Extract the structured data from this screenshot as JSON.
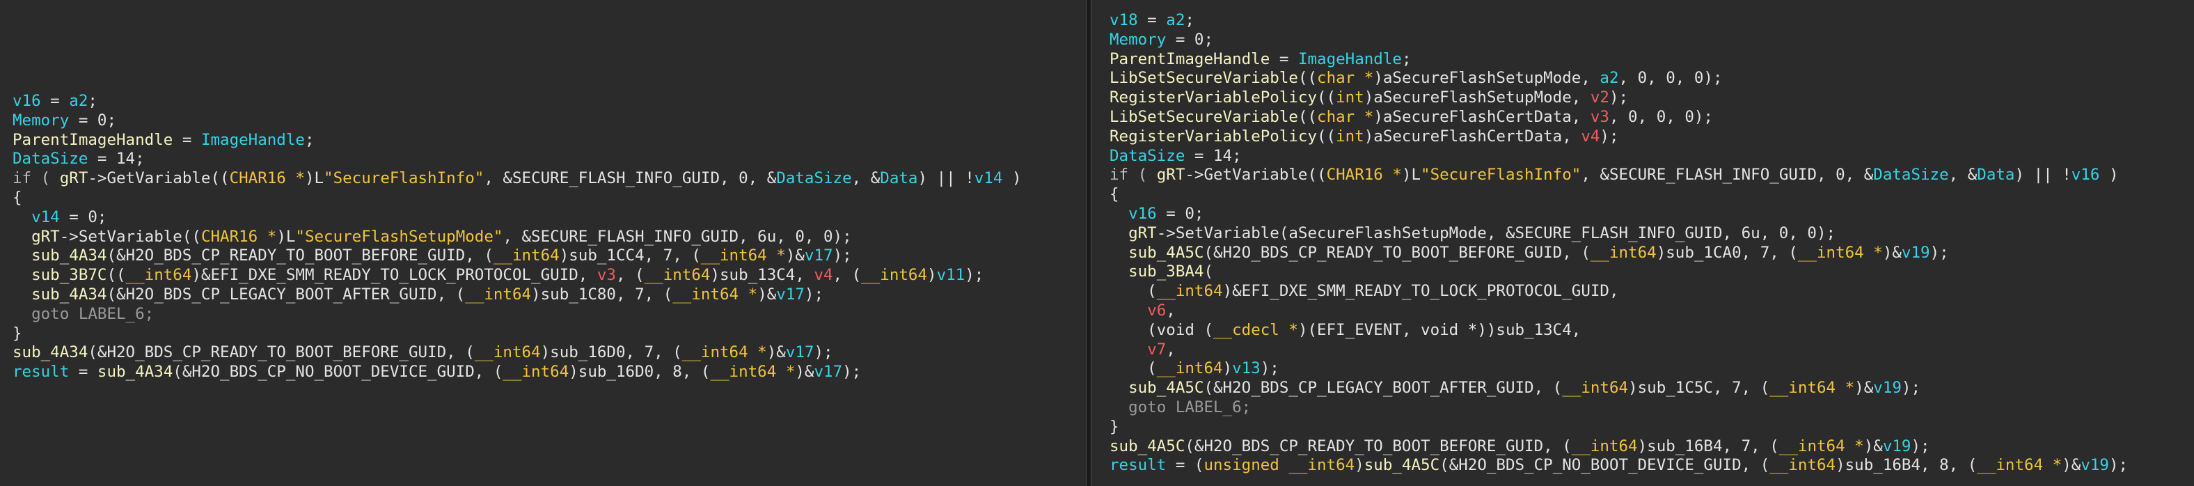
{
  "colors": {
    "background": "#2b2b2b",
    "identifier_cyan": "#37d1e6",
    "type_yellow": "#f0c33c",
    "function_cream": "#f3f1c1",
    "register_red": "#ef5d5d",
    "text_default": "#e3e3e3"
  },
  "left_pane": {
    "lines": [
      [
        {
          "t": "v16",
          "c": "var"
        },
        {
          "t": " = ",
          "c": "default"
        },
        {
          "t": "a2",
          "c": "var"
        },
        {
          "t": ";",
          "c": "default"
        }
      ],
      [
        {
          "t": "Memory",
          "c": "var"
        },
        {
          "t": " = 0;",
          "c": "default"
        }
      ],
      [
        {
          "t": "ParentImageHandle",
          "c": "fn"
        },
        {
          "t": " = ",
          "c": "default"
        },
        {
          "t": "ImageHandle",
          "c": "var"
        },
        {
          "t": ";",
          "c": "default"
        }
      ],
      [
        {
          "t": "DataSize",
          "c": "var"
        },
        {
          "t": " = 14;",
          "c": "default"
        }
      ],
      [
        {
          "t": "if ( ",
          "c": "kw"
        },
        {
          "t": "gRT",
          "c": "fn"
        },
        {
          "t": "->GetVariable((",
          "c": "default"
        },
        {
          "t": "CHAR16 *",
          "c": "type"
        },
        {
          "t": ")L",
          "c": "default"
        },
        {
          "t": "\"SecureFlashInfo\"",
          "c": "str"
        },
        {
          "t": ", &SECURE_FLASH_INFO_GUID, 0, &",
          "c": "default"
        },
        {
          "t": "DataSize",
          "c": "var"
        },
        {
          "t": ", &",
          "c": "default"
        },
        {
          "t": "Data",
          "c": "var"
        },
        {
          "t": ") || !",
          "c": "default"
        },
        {
          "t": "v14",
          "c": "var"
        },
        {
          "t": " )",
          "c": "default"
        }
      ],
      [
        {
          "t": "{",
          "c": "default"
        }
      ],
      [
        {
          "t": "  ",
          "c": "default"
        },
        {
          "t": "v14",
          "c": "var"
        },
        {
          "t": " = 0;",
          "c": "default"
        }
      ],
      [
        {
          "t": "  ",
          "c": "default"
        },
        {
          "t": "gRT",
          "c": "fn"
        },
        {
          "t": "->SetVariable((",
          "c": "default"
        },
        {
          "t": "CHAR16 *",
          "c": "type"
        },
        {
          "t": ")L",
          "c": "default"
        },
        {
          "t": "\"SecureFlashSetupMode\"",
          "c": "str"
        },
        {
          "t": ", &SECURE_FLASH_INFO_GUID, 6u, 0, 0);",
          "c": "default"
        }
      ],
      [
        {
          "t": "  ",
          "c": "default"
        },
        {
          "t": "sub_4A34",
          "c": "fn"
        },
        {
          "t": "(&H2O_BDS_CP_READY_TO_BOOT_BEFORE_GUID, (",
          "c": "default"
        },
        {
          "t": "__int64",
          "c": "type"
        },
        {
          "t": ")sub_1CC4, 7, (",
          "c": "default"
        },
        {
          "t": "__int64 *",
          "c": "type"
        },
        {
          "t": ")&",
          "c": "default"
        },
        {
          "t": "v17",
          "c": "var"
        },
        {
          "t": ");",
          "c": "default"
        }
      ],
      [
        {
          "t": "  ",
          "c": "default"
        },
        {
          "t": "sub_3B7C",
          "c": "fn"
        },
        {
          "t": "((",
          "c": "default"
        },
        {
          "t": "__int64",
          "c": "type"
        },
        {
          "t": ")&EFI_DXE_SMM_READY_TO_LOCK_PROTOCOL_GUID, ",
          "c": "default"
        },
        {
          "t": "v3",
          "c": "red"
        },
        {
          "t": ", (",
          "c": "default"
        },
        {
          "t": "__int64",
          "c": "type"
        },
        {
          "t": ")sub_13C4, ",
          "c": "default"
        },
        {
          "t": "v4",
          "c": "red"
        },
        {
          "t": ", (",
          "c": "default"
        },
        {
          "t": "__int64",
          "c": "type"
        },
        {
          "t": ")",
          "c": "default"
        },
        {
          "t": "v11",
          "c": "var"
        },
        {
          "t": ");",
          "c": "default"
        }
      ],
      [
        {
          "t": "  ",
          "c": "default"
        },
        {
          "t": "sub_4A34",
          "c": "fn"
        },
        {
          "t": "(&H2O_BDS_CP_LEGACY_BOOT_AFTER_GUID, (",
          "c": "default"
        },
        {
          "t": "__int64",
          "c": "type"
        },
        {
          "t": ")sub_1C80, 7, (",
          "c": "default"
        },
        {
          "t": "__int64 *",
          "c": "type"
        },
        {
          "t": ")&",
          "c": "default"
        },
        {
          "t": "v17",
          "c": "var"
        },
        {
          "t": ");",
          "c": "default"
        }
      ],
      [
        {
          "t": "  goto LABEL_6;",
          "c": "gray"
        }
      ],
      [
        {
          "t": "}",
          "c": "default"
        }
      ],
      [
        {
          "t": "sub_4A34",
          "c": "fn"
        },
        {
          "t": "(&H2O_BDS_CP_READY_TO_BOOT_BEFORE_GUID, (",
          "c": "default"
        },
        {
          "t": "__int64",
          "c": "type"
        },
        {
          "t": ")sub_16D0, 7, (",
          "c": "default"
        },
        {
          "t": "__int64 *",
          "c": "type"
        },
        {
          "t": ")&",
          "c": "default"
        },
        {
          "t": "v17",
          "c": "var"
        },
        {
          "t": ");",
          "c": "default"
        }
      ],
      [
        {
          "t": "result",
          "c": "var"
        },
        {
          "t": " = ",
          "c": "default"
        },
        {
          "t": "sub_4A34",
          "c": "fn"
        },
        {
          "t": "(&H2O_BDS_CP_NO_BOOT_DEVICE_GUID, (",
          "c": "default"
        },
        {
          "t": "__int64",
          "c": "type"
        },
        {
          "t": ")sub_16D0, 8, (",
          "c": "default"
        },
        {
          "t": "__int64 *",
          "c": "type"
        },
        {
          "t": ")&",
          "c": "default"
        },
        {
          "t": "v17",
          "c": "var"
        },
        {
          "t": ");",
          "c": "default"
        }
      ]
    ]
  },
  "right_pane": {
    "lines": [
      [
        {
          "t": "v18",
          "c": "var"
        },
        {
          "t": " = ",
          "c": "default"
        },
        {
          "t": "a2",
          "c": "var"
        },
        {
          "t": ";",
          "c": "default"
        }
      ],
      [
        {
          "t": "Memory",
          "c": "var"
        },
        {
          "t": " = 0;",
          "c": "default"
        }
      ],
      [
        {
          "t": "ParentImageHandle",
          "c": "fn"
        },
        {
          "t": " = ",
          "c": "default"
        },
        {
          "t": "ImageHandle",
          "c": "var"
        },
        {
          "t": ";",
          "c": "default"
        }
      ],
      [
        {
          "t": "LibSetSecureVariable",
          "c": "fn"
        },
        {
          "t": "((",
          "c": "default"
        },
        {
          "t": "char *",
          "c": "type"
        },
        {
          "t": ")aSecureFlashSetupMode, ",
          "c": "default"
        },
        {
          "t": "a2",
          "c": "var"
        },
        {
          "t": ", 0, 0, 0);",
          "c": "default"
        }
      ],
      [
        {
          "t": "RegisterVariablePolicy",
          "c": "fn"
        },
        {
          "t": "((",
          "c": "default"
        },
        {
          "t": "int",
          "c": "type"
        },
        {
          "t": ")aSecureFlashSetupMode, ",
          "c": "default"
        },
        {
          "t": "v2",
          "c": "red"
        },
        {
          "t": ");",
          "c": "default"
        }
      ],
      [
        {
          "t": "LibSetSecureVariable",
          "c": "fn"
        },
        {
          "t": "((",
          "c": "default"
        },
        {
          "t": "char *",
          "c": "type"
        },
        {
          "t": ")aSecureFlashCertData, ",
          "c": "default"
        },
        {
          "t": "v3",
          "c": "red"
        },
        {
          "t": ", 0, 0, 0);",
          "c": "default"
        }
      ],
      [
        {
          "t": "RegisterVariablePolicy",
          "c": "fn"
        },
        {
          "t": "((",
          "c": "default"
        },
        {
          "t": "int",
          "c": "type"
        },
        {
          "t": ")aSecureFlashCertData, ",
          "c": "default"
        },
        {
          "t": "v4",
          "c": "red"
        },
        {
          "t": ");",
          "c": "default"
        }
      ],
      [
        {
          "t": "DataSize",
          "c": "var"
        },
        {
          "t": " = 14;",
          "c": "default"
        }
      ],
      [
        {
          "t": "if ( ",
          "c": "kw"
        },
        {
          "t": "gRT",
          "c": "fn"
        },
        {
          "t": "->GetVariable((",
          "c": "default"
        },
        {
          "t": "CHAR16 *",
          "c": "type"
        },
        {
          "t": ")L",
          "c": "default"
        },
        {
          "t": "\"SecureFlashInfo\"",
          "c": "str"
        },
        {
          "t": ", &SECURE_FLASH_INFO_GUID, 0, &",
          "c": "default"
        },
        {
          "t": "DataSize",
          "c": "var"
        },
        {
          "t": ", &",
          "c": "default"
        },
        {
          "t": "Data",
          "c": "var"
        },
        {
          "t": ") || !",
          "c": "default"
        },
        {
          "t": "v16",
          "c": "var"
        },
        {
          "t": " )",
          "c": "default"
        }
      ],
      [
        {
          "t": "{",
          "c": "default"
        }
      ],
      [
        {
          "t": "  ",
          "c": "default"
        },
        {
          "t": "v16",
          "c": "var"
        },
        {
          "t": " = 0;",
          "c": "default"
        }
      ],
      [
        {
          "t": "  ",
          "c": "default"
        },
        {
          "t": "gRT",
          "c": "fn"
        },
        {
          "t": "->SetVariable(aSecureFlashSetupMode, &SECURE_FLASH_INFO_GUID, 6u, 0, 0);",
          "c": "default"
        }
      ],
      [
        {
          "t": "  ",
          "c": "default"
        },
        {
          "t": "sub_4A5C",
          "c": "fn"
        },
        {
          "t": "(&H2O_BDS_CP_READY_TO_BOOT_BEFORE_GUID, (",
          "c": "default"
        },
        {
          "t": "__int64",
          "c": "type"
        },
        {
          "t": ")sub_1CA0, 7, (",
          "c": "default"
        },
        {
          "t": "__int64 *",
          "c": "type"
        },
        {
          "t": ")&",
          "c": "default"
        },
        {
          "t": "v19",
          "c": "var"
        },
        {
          "t": ");",
          "c": "default"
        }
      ],
      [
        {
          "t": "  ",
          "c": "default"
        },
        {
          "t": "sub_3BA4",
          "c": "fn"
        },
        {
          "t": "(",
          "c": "default"
        }
      ],
      [
        {
          "t": "    (",
          "c": "default"
        },
        {
          "t": "__int64",
          "c": "type"
        },
        {
          "t": ")&EFI_DXE_SMM_READY_TO_LOCK_PROTOCOL_GUID,",
          "c": "default"
        }
      ],
      [
        {
          "t": "    ",
          "c": "default"
        },
        {
          "t": "v6",
          "c": "red"
        },
        {
          "t": ",",
          "c": "default"
        }
      ],
      [
        {
          "t": "    (void (",
          "c": "default"
        },
        {
          "t": "__cdecl *",
          "c": "type"
        },
        {
          "t": ")(EFI_EVENT, void *))sub_13C4,",
          "c": "default"
        }
      ],
      [
        {
          "t": "    ",
          "c": "default"
        },
        {
          "t": "v7",
          "c": "red"
        },
        {
          "t": ",",
          "c": "default"
        }
      ],
      [
        {
          "t": "    (",
          "c": "default"
        },
        {
          "t": "__int64",
          "c": "type"
        },
        {
          "t": ")",
          "c": "default"
        },
        {
          "t": "v13",
          "c": "var"
        },
        {
          "t": ");",
          "c": "default"
        }
      ],
      [
        {
          "t": "  ",
          "c": "default"
        },
        {
          "t": "sub_4A5C",
          "c": "fn"
        },
        {
          "t": "(&H2O_BDS_CP_LEGACY_BOOT_AFTER_GUID, (",
          "c": "default"
        },
        {
          "t": "__int64",
          "c": "type"
        },
        {
          "t": ")sub_1C5C, 7, (",
          "c": "default"
        },
        {
          "t": "__int64 *",
          "c": "type"
        },
        {
          "t": ")&",
          "c": "default"
        },
        {
          "t": "v19",
          "c": "var"
        },
        {
          "t": ");",
          "c": "default"
        }
      ],
      [
        {
          "t": "  goto LABEL_6;",
          "c": "gray"
        }
      ],
      [
        {
          "t": "}",
          "c": "default"
        }
      ],
      [
        {
          "t": "sub_4A5C",
          "c": "fn"
        },
        {
          "t": "(&H2O_BDS_CP_READY_TO_BOOT_BEFORE_GUID, (",
          "c": "default"
        },
        {
          "t": "__int64",
          "c": "type"
        },
        {
          "t": ")sub_16B4, 7, (",
          "c": "default"
        },
        {
          "t": "__int64 *",
          "c": "type"
        },
        {
          "t": ")&",
          "c": "default"
        },
        {
          "t": "v19",
          "c": "var"
        },
        {
          "t": ");",
          "c": "default"
        }
      ],
      [
        {
          "t": "result",
          "c": "var"
        },
        {
          "t": " = (",
          "c": "default"
        },
        {
          "t": "unsigned __int64",
          "c": "type"
        },
        {
          "t": ")",
          "c": "default"
        },
        {
          "t": "sub_4A5C",
          "c": "fn"
        },
        {
          "t": "(&H2O_BDS_CP_NO_BOOT_DEVICE_GUID, (",
          "c": "default"
        },
        {
          "t": "__int64",
          "c": "type"
        },
        {
          "t": ")sub_16B4, 8, (",
          "c": "default"
        },
        {
          "t": "__int64 *",
          "c": "type"
        },
        {
          "t": ")&",
          "c": "default"
        },
        {
          "t": "v19",
          "c": "var"
        },
        {
          "t": ");",
          "c": "default"
        }
      ]
    ]
  }
}
